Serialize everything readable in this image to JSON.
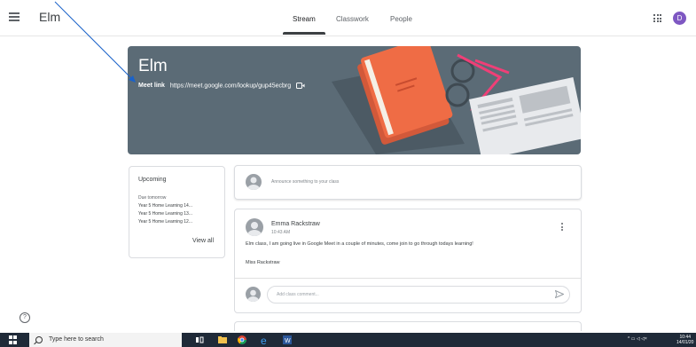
{
  "header": {
    "class_name": "Elm",
    "tabs": [
      {
        "label": "Stream",
        "active": true
      },
      {
        "label": "Classwork",
        "active": false
      },
      {
        "label": "People",
        "active": false
      }
    ],
    "avatar_letter": "D",
    "avatar_color": "#7e57c2"
  },
  "banner": {
    "title": "Elm",
    "meet_label": "Meet link",
    "meet_url": "https://meet.google.com/lookup/gup45ecbrg",
    "background_color": "#5b6b76"
  },
  "upcoming": {
    "title": "Upcoming",
    "due_label": "Due tomorrow",
    "items": [
      "Year 5 Home Learning 14...",
      "Year 5 Home Learning 13...",
      "Year 5 Home Learning 12..."
    ],
    "view_all": "View all"
  },
  "announce": {
    "placeholder": "Announce something to your class"
  },
  "post": {
    "author": "Emma Rackstraw",
    "time": "10:43 AM",
    "body": "Elm class, I am going live in Google Meet in a couple of minutes, come join to go through todays learning!",
    "signature": "Miss Rackstraw",
    "comment_placeholder": "Add class comment..."
  },
  "taskbar": {
    "search_placeholder": "Type here to search",
    "clock_time": "10:44",
    "clock_date": "14/01/20"
  }
}
